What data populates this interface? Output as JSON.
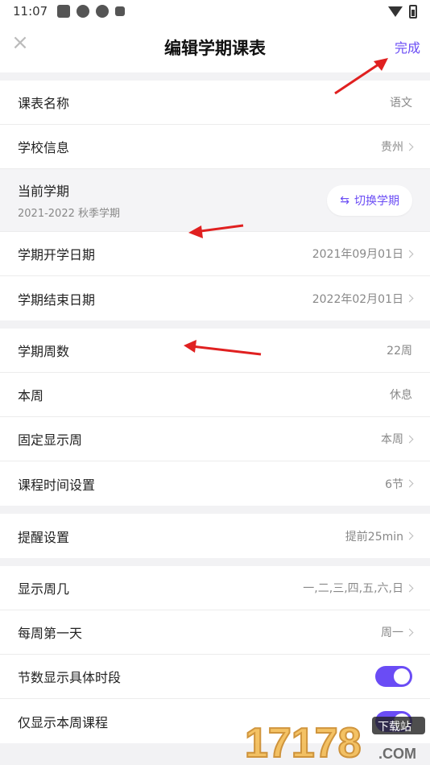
{
  "status_bar": {
    "time": "11:07"
  },
  "header": {
    "title": "编辑学期课表",
    "done_label": "完成",
    "close_glyph": "×"
  },
  "rows": {
    "course_name": {
      "label": "课表名称",
      "value": "语文"
    },
    "school_info": {
      "label": "学校信息",
      "value": "贵州"
    },
    "semester": {
      "label": "当前学期",
      "sub": "2021-2022 秋季学期",
      "switch_label": "切换学期",
      "switch_glyph": "⇆"
    },
    "start_date": {
      "label": "学期开学日期",
      "value": "2021年09月01日"
    },
    "end_date": {
      "label": "学期结束日期",
      "value": "2022年02月01日"
    },
    "weeks": {
      "label": "学期周数",
      "value": "22周"
    },
    "current_week": {
      "label": "本周",
      "value": "休息"
    },
    "fixed_week": {
      "label": "固定显示周",
      "value": "本周"
    },
    "time_settings": {
      "label": "课程时间设置",
      "value": "6节"
    },
    "reminder": {
      "label": "提醒设置",
      "value": "提前25min"
    },
    "weekdays": {
      "label": "显示周几",
      "value": "一,二,三,四,五,六,日"
    },
    "first_day": {
      "label": "每周第一天",
      "value": "周一"
    },
    "show_periods": {
      "label": "节数显示具体时段",
      "toggle": true
    },
    "current_only": {
      "label": "仅显示本周课程",
      "toggle": true
    }
  },
  "watermark": {
    "number": "17178",
    "domain": ".COM",
    "tag": "下载站"
  },
  "colors": {
    "accent": "#6a4cf5",
    "annotation": "#e02020"
  }
}
